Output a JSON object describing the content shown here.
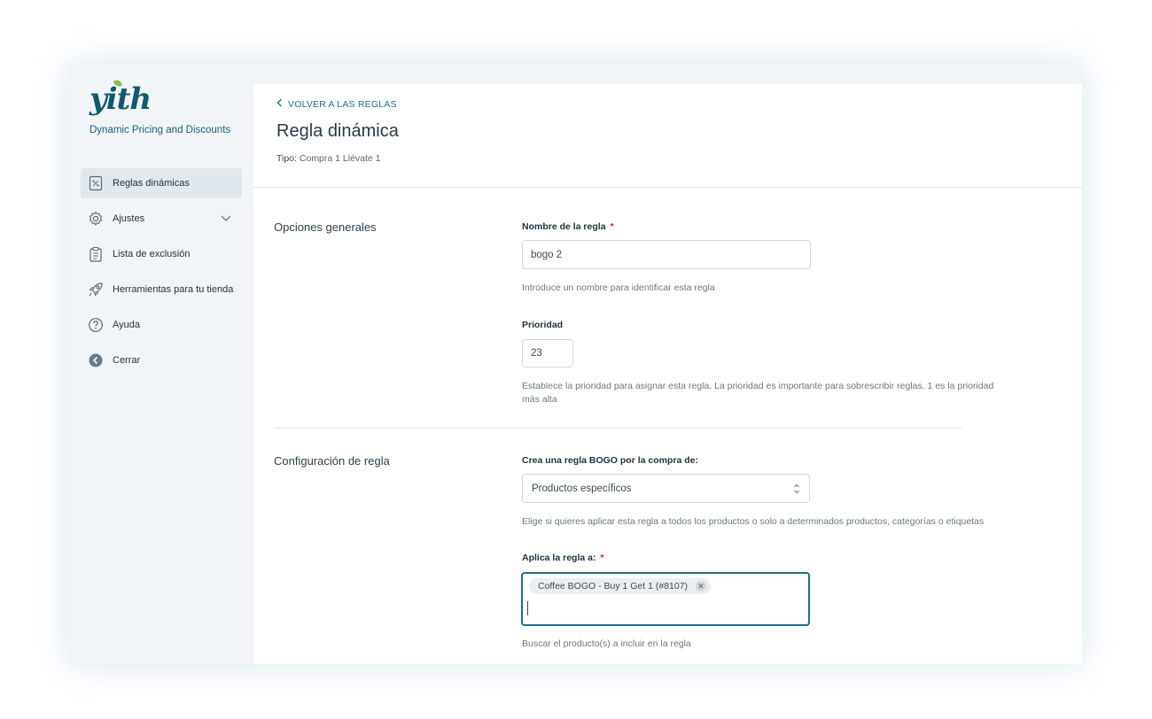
{
  "sidebar": {
    "logo": "yith",
    "app_name": "Dynamic Pricing and Discounts",
    "items": [
      {
        "label": "Reglas dinámicas",
        "icon": "rule-document-icon",
        "active": true
      },
      {
        "label": "Ajustes",
        "icon": "gear-icon",
        "expandable": true
      },
      {
        "label": "Lista de exclusión",
        "icon": "clipboard-list-icon"
      },
      {
        "label": "Herramientas para tu tienda",
        "icon": "rocket-icon"
      },
      {
        "label": "Ayuda",
        "icon": "question-circle-icon"
      },
      {
        "label": "Cerrar",
        "icon": "arrow-left-circle-icon"
      }
    ]
  },
  "header": {
    "back_label": "VOLVER A LAS REGLAS",
    "title": "Regla dinámica",
    "type_label": "Tipo:",
    "type_value": "Compra 1 Llévate 1"
  },
  "general": {
    "section_title": "Opciones generales",
    "name_label": "Nombre de la regla",
    "name_required": "*",
    "name_value": "bogo 2",
    "name_help": "Introduce un nombre para identificar esta regla",
    "priority_label": "Prioridad",
    "priority_value": "23",
    "priority_help": "Establece la prioridad para asignar esta regla. La prioridad es importante para sobrescribir reglas. 1 es la prioridad más alta"
  },
  "config": {
    "section_title": "Configuración de regla",
    "bogo_label": "Crea una regla BOGO por la compra de:",
    "bogo_selected": "Productos específicos",
    "bogo_help": "Elige si quieres aplicar esta regla a todos los productos o solo a determinados productos, categorías o etiquetas",
    "apply_label": "Aplica la regla a:",
    "apply_required": "*",
    "apply_tags": [
      "Coffee BOGO - Buy 1 Get 1 (#8107)"
    ],
    "apply_help": "Buscar el producto(s) a incluir en la regla"
  },
  "colors": {
    "accent": "#1d6e8a",
    "sidebar_bg": "#f1f5f8",
    "required": "#d0243b"
  }
}
